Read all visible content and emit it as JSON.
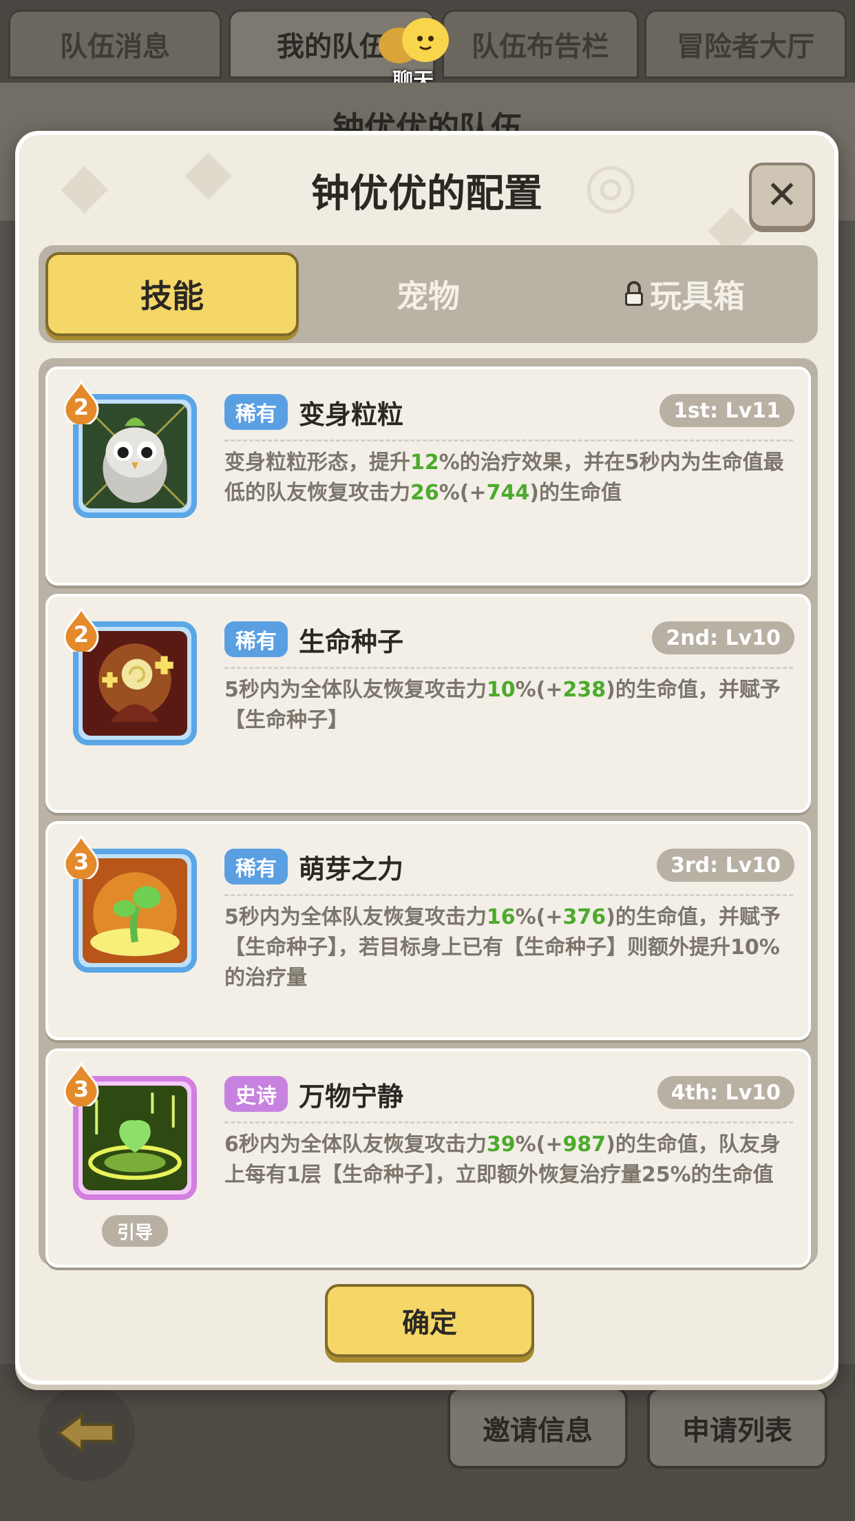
{
  "top_tabs": [
    "队伍消息",
    "我的队伍",
    "队伍布告栏",
    "冒险者大厅"
  ],
  "chat_label": "聊天",
  "bg_header_title": "钟优优的队伍",
  "modal": {
    "title": "钟优优的配置",
    "tabs": [
      {
        "label": "技能",
        "active": true,
        "locked": false
      },
      {
        "label": "宠物",
        "active": false,
        "locked": false
      },
      {
        "label": "玩具箱",
        "active": false,
        "locked": true
      }
    ],
    "skills": [
      {
        "level": "2",
        "rarity": "稀有",
        "rarity_type": "rare",
        "name": "变身粒粒",
        "slot": "1st: Lv11",
        "desc_parts": [
          "变身粒粒形态，提升",
          "12",
          "%的治疗效果，并在5秒内为生命值最低的队友恢复攻击力",
          "26",
          "%(+",
          "744",
          ")的生命值"
        ]
      },
      {
        "level": "2",
        "rarity": "稀有",
        "rarity_type": "rare",
        "name": "生命种子",
        "slot": "2nd: Lv10",
        "desc_parts": [
          "5秒内为全体队友恢复攻击力",
          "10",
          "%(+",
          "238",
          ")的生命值，并赋予【生命种子】"
        ]
      },
      {
        "level": "3",
        "rarity": "稀有",
        "rarity_type": "rare",
        "name": "萌芽之力",
        "slot": "3rd: Lv10",
        "desc_parts": [
          "5秒内为全体队友恢复攻击力",
          "16",
          "%(+",
          "376",
          ")的生命值，并赋予【生命种子】，若目标身上已有【生命种子】则额外提升10%的治疗量"
        ]
      },
      {
        "level": "3",
        "rarity": "史诗",
        "rarity_type": "epic",
        "name": "万物宁静",
        "slot": "4th: Lv10",
        "desc_parts": [
          "6秒内为全体队友恢复攻击力",
          "39",
          "%(+",
          "987",
          ")的生命值，队友身上每有1层【生命种子】，立即额外恢复治疗量25%的生命值"
        ],
        "tag": "引导"
      }
    ],
    "confirm_label": "确定"
  },
  "bottom_buttons": [
    "邀请信息",
    "申请列表"
  ],
  "colors": {
    "accent_yellow": "#f5d768",
    "rare_blue": "#5b9fe3",
    "epic_purple": "#c782df",
    "number_green": "#4caa2c"
  }
}
